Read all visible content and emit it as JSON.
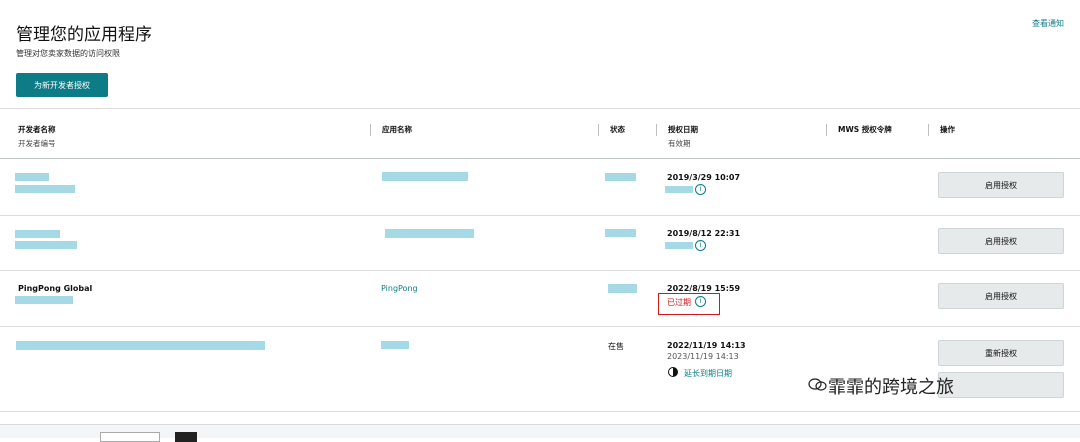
{
  "header": {
    "title": "管理您的应用程序",
    "subtitle": "管理对您卖家数据的访问权限",
    "notifications_link": "查看通知",
    "authorize_button": "为新开发者授权"
  },
  "table": {
    "columns": {
      "developer_name": "开发者名称",
      "developer_id": "开发者编号",
      "app_name": "应用名称",
      "status": "状态",
      "auth_date": "授权日期",
      "valid_until": "有效期",
      "mws_token": "MWS 授权令牌",
      "actions": "操作"
    },
    "rows": [
      {
        "auth_date": "2019/3/29 10:07",
        "action": "启用授权"
      },
      {
        "auth_date": "2019/8/12 22:31",
        "action": "启用授权"
      },
      {
        "developer_name": "PingPong Global",
        "app_name": "PingPong",
        "auth_date": "2022/8/19 15:59",
        "valid": "已过期",
        "action": "启用授权"
      },
      {
        "status": "在售",
        "auth_date": "2022/11/19 14:13",
        "valid": "2023/11/19 14:13",
        "extend": "延长到期日期",
        "action": "重新授权"
      }
    ]
  },
  "watermark": "霏霏的跨境之旅",
  "colors": {
    "accent": "#0e7c86",
    "expired": "#d0191c",
    "redaction": "#a6d9e6"
  },
  "icons": {
    "info": "info-circle-icon",
    "clock": "clock-icon",
    "wechat": "wechat-icon"
  }
}
